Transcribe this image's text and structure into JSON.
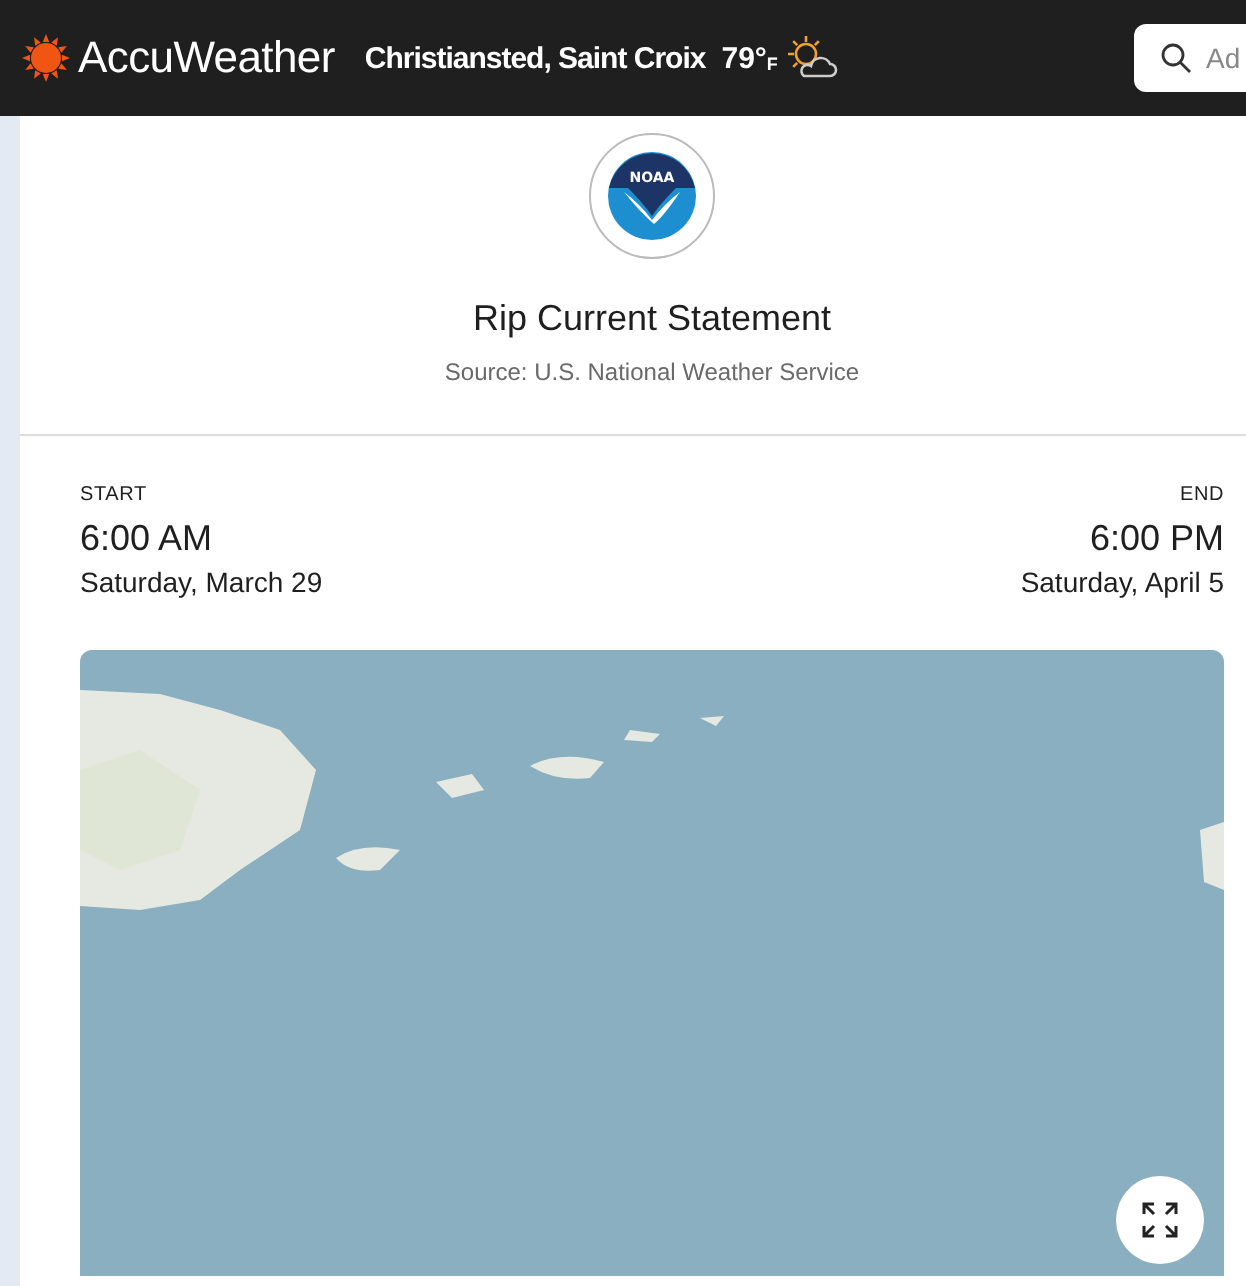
{
  "header": {
    "brand": "AccuWeather",
    "location": "Christiansted, Saint Croix",
    "temperature": "79°",
    "unit": "F",
    "search": {
      "placeholder": "Ad"
    }
  },
  "alert": {
    "logo_text": "NOAA",
    "title": "Rip Current Statement",
    "source": "Source: U.S. National Weather Service"
  },
  "period": {
    "start": {
      "label": "START",
      "time": "6:00 AM",
      "date": "Saturday, March 29"
    },
    "end": {
      "label": "END",
      "time": "6:00 PM",
      "date": "Saturday, April 5"
    }
  }
}
